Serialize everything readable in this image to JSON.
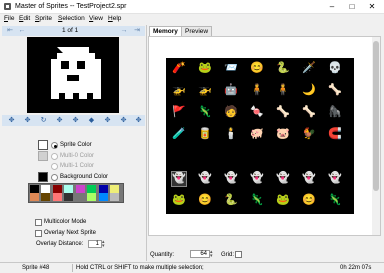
{
  "window": {
    "title": "Master of Sprites -- TestProject2.spr",
    "minimize": "–",
    "maximize": "□",
    "close": "✕"
  },
  "menu": [
    "File",
    "Edit",
    "Sprite",
    "Selection",
    "View",
    "Help"
  ],
  "left": {
    "nav": {
      "first": "⇤",
      "prev": "←",
      "counter": "1 of 1",
      "next": "→",
      "last": "⇥"
    },
    "tool_buttons": [
      "✥",
      "✥",
      "↻",
      "✥",
      "✥",
      "◆",
      "✥",
      "✥",
      "✥"
    ],
    "color_options": [
      {
        "label": "Sprite Color",
        "selected": true,
        "enabled": true,
        "color": "#ffffff"
      },
      {
        "label": "Multi-0 Color",
        "selected": false,
        "enabled": false,
        "color": "#d0d0d0"
      },
      {
        "label": "Multi-1 Color",
        "selected": false,
        "enabled": false,
        "color": ""
      },
      {
        "label": "Background Color",
        "selected": false,
        "enabled": true,
        "color": "#000000"
      }
    ],
    "palette": [
      "#000000",
      "#ffffff",
      "#880000",
      "#aaffee",
      "#cc44cc",
      "#00cc55",
      "#0000aa",
      "#eeee77",
      "#dd8855",
      "#664400",
      "#ff7777",
      "#333333",
      "#777777",
      "#aaff66",
      "#0088ff",
      "#bbbbbb"
    ],
    "multicolor_label": "Multicolor Mode",
    "overlay_label": "Overlay Next Sprite",
    "overlay_distance_label": "Overlay Distance:",
    "overlay_distance_value": "1"
  },
  "right": {
    "tabs": [
      {
        "label": "Memory",
        "active": true
      },
      {
        "label": "Preview",
        "active": false
      }
    ],
    "quantity_label": "Quantity:",
    "quantity_value": "64",
    "grid_label": "Grid:"
  },
  "sprites": [
    "🧨",
    "🐸",
    "📨",
    "😊",
    "🐍",
    "🗡️",
    "💀",
    "🚁",
    "🚁",
    "🤖",
    "🧍",
    "🧍",
    "🌙",
    "🦴",
    "🚩",
    "🦎",
    "🧑",
    "🍬",
    "🦴",
    "🦴",
    "🦍",
    "🧪",
    "🥫",
    "🕯️",
    "🐖",
    "🐷",
    "🐓",
    "🧲",
    "",
    "",
    "",
    "",
    "",
    "",
    "",
    "👻",
    "👻",
    "👻",
    "👻",
    "👻",
    "👻",
    "👻",
    "🐸",
    "😊",
    "🐍",
    "🦎",
    "🐸",
    "😊",
    "🦎"
  ],
  "status": {
    "sprite": "Sprite #48",
    "hint": "Hold CTRL or SHIFT to make multiple selection;",
    "time": "0h 22m 07s"
  }
}
